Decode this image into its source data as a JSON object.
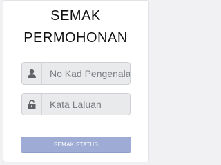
{
  "form": {
    "title_line1": "SEMAK",
    "title_line2": "PERMOHONAN",
    "id_field": {
      "placeholder": "No Kad Pengenalan",
      "value": "",
      "icon": "user-icon"
    },
    "password_field": {
      "placeholder": "Kata Laluan",
      "value": "",
      "icon": "unlock-icon"
    },
    "submit_label": "SEMAK STATUS"
  },
  "colors": {
    "button_bg": "#9eabd4",
    "input_bg": "#e9eaec",
    "icon": "#5f6368"
  }
}
